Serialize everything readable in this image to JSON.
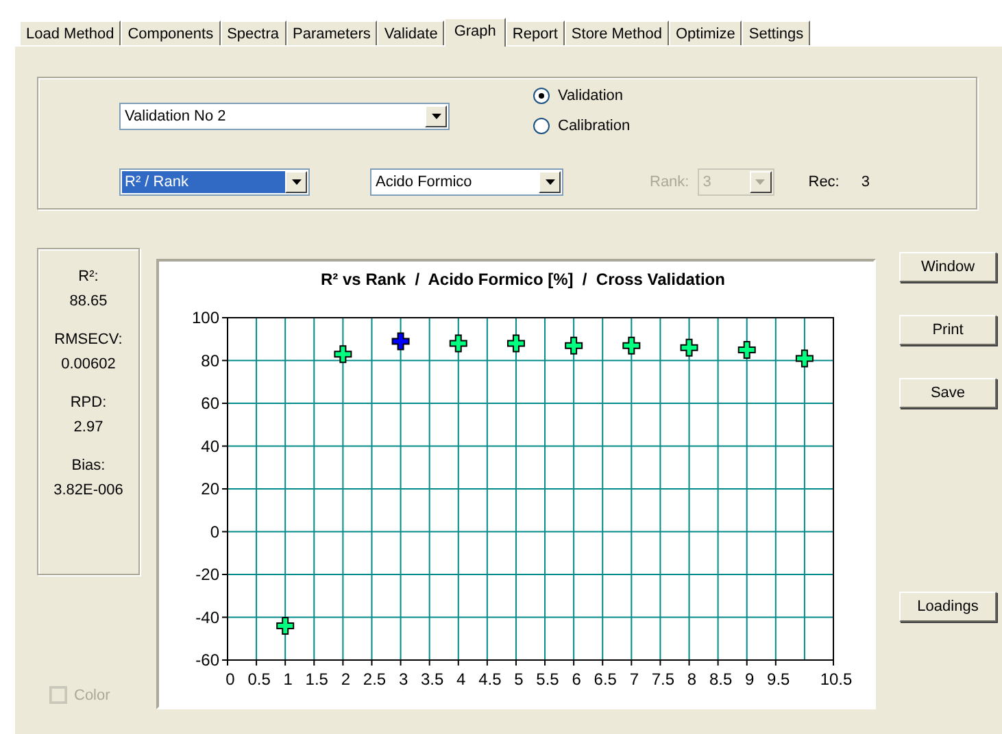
{
  "tabs": [
    {
      "label": "Load Method",
      "selected": false
    },
    {
      "label": "Components",
      "selected": false
    },
    {
      "label": "Spectra",
      "selected": false
    },
    {
      "label": "Parameters",
      "selected": false
    },
    {
      "label": "Validate",
      "selected": false
    },
    {
      "label": "Graph",
      "selected": true
    },
    {
      "label": "Report",
      "selected": false
    },
    {
      "label": "Store Method",
      "selected": false
    },
    {
      "label": "Optimize",
      "selected": false
    },
    {
      "label": "Settings",
      "selected": false
    }
  ],
  "validation_select": {
    "value": "Validation No 2",
    "highlighted": false,
    "disabled": false
  },
  "mode_radios": [
    {
      "label": "Validation",
      "selected": true
    },
    {
      "label": "Calibration",
      "selected": false
    }
  ],
  "plot_select": {
    "value": "R² / Rank",
    "highlighted": true,
    "disabled": false
  },
  "component_select": {
    "value": "Acido Formico",
    "highlighted": false,
    "disabled": false
  },
  "rank": {
    "label": "Rank:",
    "value": "3",
    "highlighted": false,
    "disabled": true
  },
  "rec": {
    "label": "Rec:",
    "value": "3"
  },
  "stats": [
    {
      "label": "R²:",
      "value": "88.65"
    },
    {
      "label": "RMSECV:",
      "value": "0.00602"
    },
    {
      "label": "RPD:",
      "value": "2.97"
    },
    {
      "label": "Bias:",
      "value": "3.82E-006"
    }
  ],
  "color_checkbox": {
    "label": "Color",
    "checked": false,
    "disabled": true
  },
  "chart": {
    "chart_data": {
      "type": "scatter",
      "title": "R² vs Rank  /  Acido Formico [%]  /  Cross Validation",
      "x": [
        1,
        2,
        3,
        4,
        5,
        6,
        7,
        8,
        9,
        10
      ],
      "grid": true,
      "series": [
        {
          "color": "#00ff80",
          "values": [
            -44,
            83,
            null,
            88,
            88,
            87,
            87,
            86,
            85,
            81
          ]
        },
        {
          "color": "#0000ff",
          "values": [
            null,
            null,
            89,
            null,
            null,
            null,
            null,
            null,
            null,
            null
          ]
        }
      ],
      "xlim": [
        0,
        10.5
      ],
      "ylim": [
        -60,
        100
      ],
      "xticks": [
        {
          "value": 0,
          "label": "0"
        },
        {
          "value": 0.5,
          "label": "0.5"
        },
        {
          "value": 1,
          "label": "1"
        },
        {
          "value": 1.5,
          "label": "1.5"
        },
        {
          "value": 2,
          "label": "2"
        },
        {
          "value": 2.5,
          "label": "2.5"
        },
        {
          "value": 3,
          "label": "3"
        },
        {
          "value": 3.5,
          "label": "3.5"
        },
        {
          "value": 4,
          "label": "4"
        },
        {
          "value": 4.5,
          "label": "4.5"
        },
        {
          "value": 5,
          "label": "5"
        },
        {
          "value": 5.5,
          "label": "5.5"
        },
        {
          "value": 6,
          "label": "6"
        },
        {
          "value": 6.5,
          "label": "6.5"
        },
        {
          "value": 7,
          "label": "7"
        },
        {
          "value": 7.5,
          "label": "7.5"
        },
        {
          "value": 8,
          "label": "8"
        },
        {
          "value": 8.5,
          "label": "8.5"
        },
        {
          "value": 9,
          "label": "9"
        },
        {
          "value": 9.5,
          "label": "9.5"
        },
        {
          "value": 10.5,
          "label": "10.5"
        }
      ],
      "yticks": [
        -60,
        -40,
        -20,
        0,
        20,
        40,
        60,
        80,
        100
      ]
    }
  },
  "buttons": [
    {
      "label": "Window",
      "kind": "top"
    },
    {
      "label": "Print",
      "kind": "top"
    },
    {
      "label": "Save",
      "kind": "top"
    },
    {
      "label": "Loadings",
      "kind": "bottom"
    }
  ]
}
